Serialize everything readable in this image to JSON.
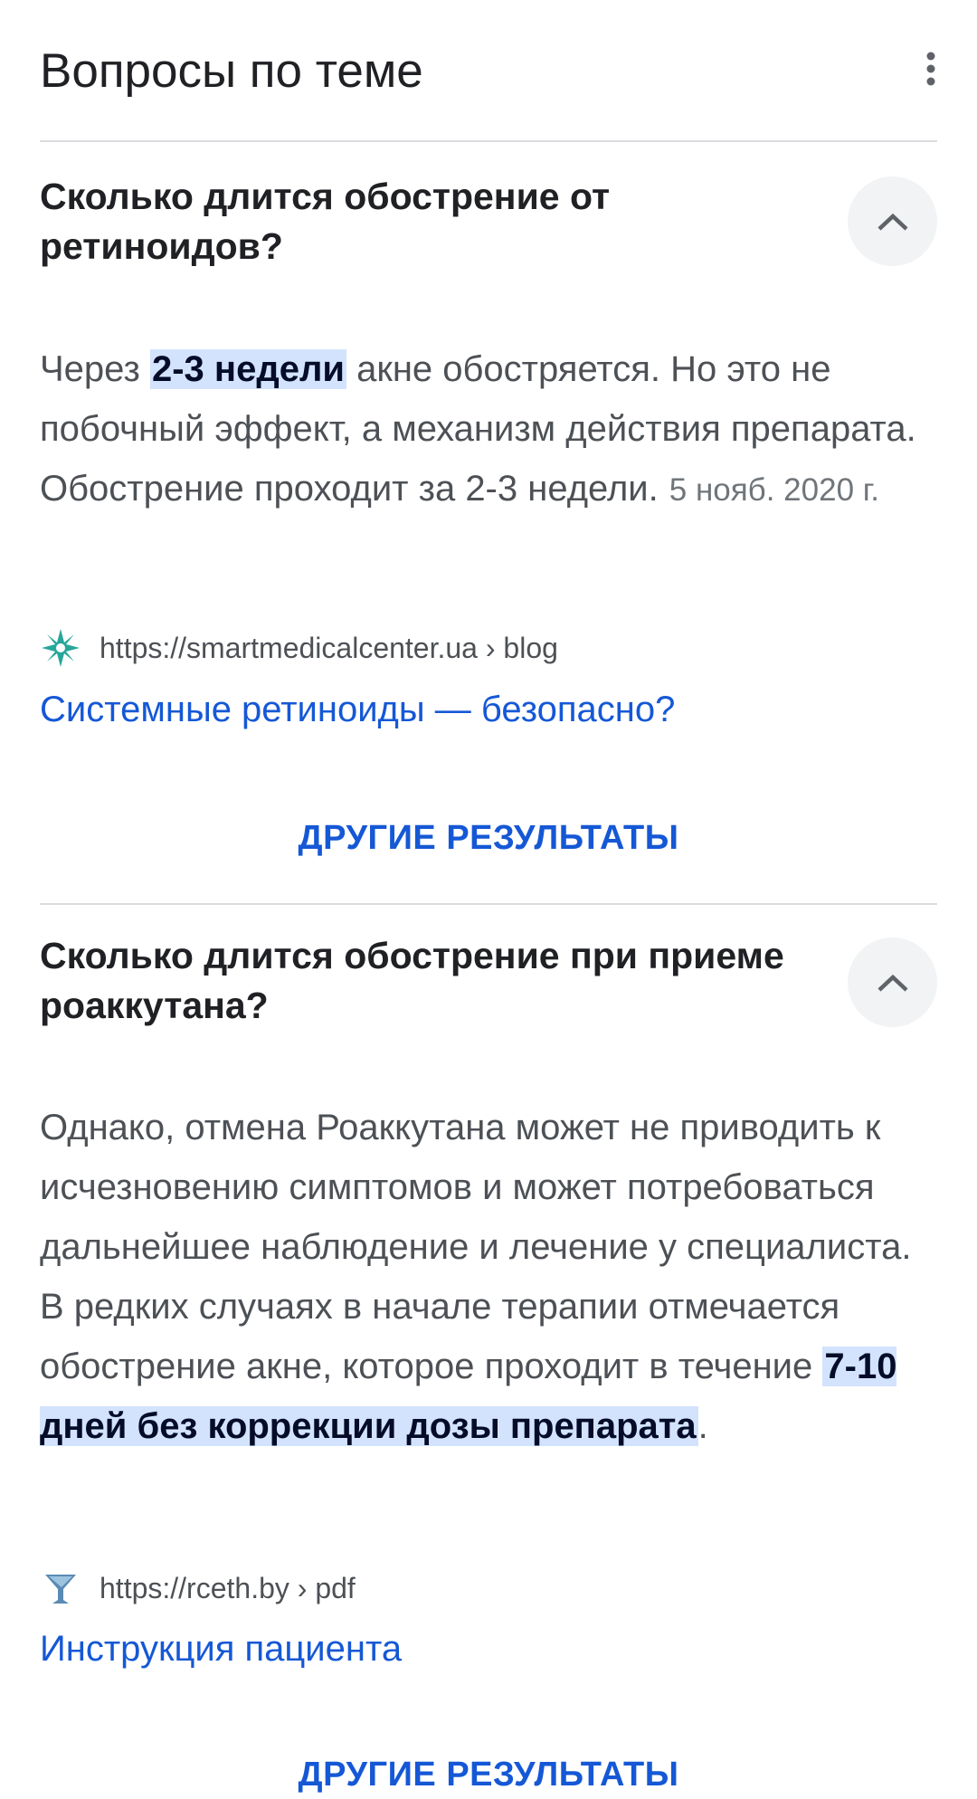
{
  "header": {
    "title": "Вопросы по теме"
  },
  "items": [
    {
      "question": "Сколько длится обострение от ретиноидов?",
      "answer_pre": "Через ",
      "answer_highlight": "2-3 недели",
      "answer_post": " акне обостряется. Но это не побочный эффект, а механизм действия препарата. Обострение проходит за 2-3 недели.",
      "date": "5 нояб. 2020 г.",
      "source_url": "https://smartmedicalcenter.ua › blog",
      "link_text": "Системные ретиноиды — безопасно?",
      "more_results": "ДРУГИЕ РЕЗУЛЬТАТЫ"
    },
    {
      "question": "Сколько длится обострение при приеме роаккутана?",
      "answer_pre": "Однако, отмена Роаккутана может не приводить к исчезновению симптомов и может потребоваться дальнейшее наблюдение и лечение у специалиста. В редких случаях в начале терапии отмечается обострение акне, которое проходит в течение ",
      "answer_highlight": "7-10 дней без коррекции дозы препарата",
      "answer_post": ".",
      "source_url": "https://rceth.by › pdf",
      "link_text": "Инструкция пациента",
      "more_results": "ДРУГИЕ РЕЗУЛЬТАТЫ"
    }
  ],
  "icons": {
    "more": "more-vert-icon",
    "collapse": "chevron-up-icon",
    "favicon1": "star-burst-favicon",
    "favicon2": "goblet-favicon"
  },
  "colors": {
    "link": "#1558d6",
    "highlight": "#d3e3fd",
    "chevron_bg": "#f1f3f4",
    "divider": "#dadce0"
  }
}
